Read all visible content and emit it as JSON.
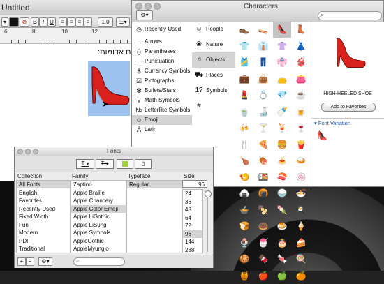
{
  "document": {
    "title": "Untitled",
    "font_size": "1.0",
    "ruler_numbers": [
      "6",
      "8",
      "10",
      "12"
    ],
    "text_line": "נעליים אדומות:"
  },
  "characters": {
    "window_title": "Characters",
    "categories": [
      {
        "icon": "clock-icon",
        "glyph": "◷",
        "label": "Recently Used"
      },
      {
        "icon": "arrow-icon",
        "glyph": "→",
        "label": "Arrows"
      },
      {
        "icon": "parentheses-icon",
        "glyph": "()",
        "label": "Parentheses"
      },
      {
        "icon": "punctuation-icon",
        "glyph": ".,",
        "label": "Punctuation"
      },
      {
        "icon": "dollar-icon",
        "glyph": "$",
        "label": "Currency Symbols"
      },
      {
        "icon": "pictograph-icon",
        "glyph": "☑",
        "label": "Pictographs"
      },
      {
        "icon": "bullet-star-icon",
        "glyph": "✻",
        "label": "Bullets/Stars"
      },
      {
        "icon": "sqrt-icon",
        "glyph": "√",
        "label": "Math Symbols"
      },
      {
        "icon": "numero-icon",
        "glyph": "№",
        "label": "Letterlike Symbols"
      },
      {
        "icon": "smiley-icon",
        "glyph": "☺",
        "label": "Emoji"
      },
      {
        "icon": "latin-icon",
        "glyph": "Á",
        "label": "Latin"
      }
    ],
    "selected_category": "Emoji",
    "subcategories": [
      {
        "icon": "people-icon",
        "glyph": "☺",
        "label": "People"
      },
      {
        "icon": "nature-icon",
        "glyph": "❀",
        "label": "Nature"
      },
      {
        "icon": "bell-icon",
        "glyph": "♫",
        "label": "Objects"
      },
      {
        "icon": "car-icon",
        "glyph": "⛟",
        "label": "Places"
      },
      {
        "icon": "symbols-icon",
        "glyph": "1?#",
        "label": "Symbols"
      }
    ],
    "selected_subcategory": "Objects",
    "grid": [
      "👞",
      "👡",
      "👠",
      "👢",
      "👕",
      "👔",
      "👚",
      "👗",
      "🎽",
      "👖",
      "👘",
      "👙",
      "💼",
      "👜",
      "👝",
      "👛",
      "💄",
      "💍",
      "💎",
      "☕",
      "🍵",
      "🍶",
      "🍼",
      "🍺",
      "🍻",
      "🍸",
      "🍹",
      "🍷",
      "🍴",
      "🍕",
      "🍔",
      "🍟",
      "🍗",
      "🍖",
      "🍝",
      "🍛",
      "🍤",
      "🍱",
      "🍣",
      "🍥",
      "🍙",
      "🍘",
      "🍚",
      "🍜",
      "🍲",
      "🍢",
      "🍡",
      "🍳",
      "🍞",
      "🍩",
      "🍮",
      "🍦",
      "🍨",
      "🍧",
      "🎂",
      "🍰",
      "🍪",
      "🍫",
      "🍬",
      "🍭",
      "🍯",
      "🍎",
      "🍏",
      "🍊"
    ],
    "selected_glyph": "👠",
    "preview_name": "HIGH-HEELED SHOE",
    "add_favorites_label": "Add to Favorites",
    "font_variation_label": "Font Variation",
    "variation_glyph": "👠"
  },
  "fonts": {
    "window_title": "Fonts",
    "headers": {
      "collection": "Collection",
      "family": "Family",
      "typeface": "Typeface",
      "size": "Size"
    },
    "collections": [
      "All Fonts",
      "English",
      "Favorites",
      "Recently Used",
      "Fixed Width",
      "Fun",
      "Modern",
      "PDF",
      "Traditional"
    ],
    "selected_collection": "All Fonts",
    "families": [
      "Zapfino",
      "Apple Braille",
      "Apple Chancery",
      "Apple Color Emoji",
      "Apple LiGothic",
      "Apple LiSung",
      "Apple Symbols",
      "AppleGothic",
      "AppleMyungjo"
    ],
    "selected_family": "Apple Color Emoji",
    "typefaces": [
      "Regular"
    ],
    "selected_typeface": "Regular",
    "size_value": "96",
    "sizes": [
      "24",
      "36",
      "48",
      "64",
      "72",
      "96",
      "144",
      "288"
    ],
    "selected_size": "96"
  },
  "colors": {
    "accent_red": "#d8201c",
    "selection_blue": "#9ec2f0",
    "selected_gray": "#d4d4d4"
  }
}
